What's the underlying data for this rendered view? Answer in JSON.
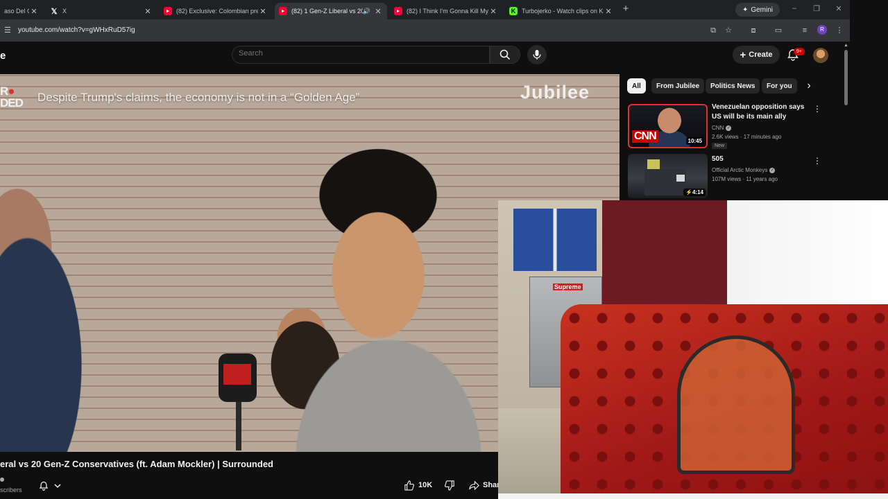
{
  "browser": {
    "tabs": [
      {
        "title": "aso Del G",
        "favicon": "site-icon",
        "active": false
      },
      {
        "title": "X",
        "favicon": "x-icon",
        "active": false
      },
      {
        "title": "(82) Exclusive: Colombian pres",
        "favicon": "youtube-icon",
        "active": false
      },
      {
        "title": "(82) 1 Gen-Z Liberal vs 20 G",
        "favicon": "youtube-icon",
        "active": true,
        "audio": true
      },
      {
        "title": "(82) I Think I'm Gonna Kill Mys",
        "favicon": "youtube-icon",
        "active": false
      },
      {
        "title": "Turbojerko - Watch clips on Ki",
        "favicon": "kick-icon",
        "active": false
      }
    ],
    "new_tab": "+",
    "gemini_label": "Gemini",
    "url": "youtube.com/watch?v=gWHxRuD57ig",
    "profile_initial": "R"
  },
  "youtube": {
    "logo_fragment": "e",
    "search_placeholder": "Search",
    "create_label": "Create",
    "notification_count": "9+",
    "video": {
      "overlay_left": [
        "R",
        "DED"
      ],
      "caption": "Despite Trump's claims, the economy is not in a “Golden Age”",
      "brand": "Jubilee",
      "title": "eral vs 20 Gen-Z Conservatives (ft. Adam Mockler) | Surrounded",
      "subscribers_fragment": "scribers",
      "likes": "10K",
      "share_label": "Shar"
    },
    "chips": [
      {
        "label": "All",
        "active": true
      },
      {
        "label": "From Jubilee",
        "active": false
      },
      {
        "label": "Politics News",
        "active": false
      },
      {
        "label": "For you",
        "active": false
      }
    ],
    "recommendations": [
      {
        "title": "Venezuelan opposition says US will be its main ally",
        "channel": "CNN",
        "verified": true,
        "meta": "2.6K views · 17 minutes ago",
        "badge": "New",
        "duration": "10:45",
        "thumb_text": "CNN"
      },
      {
        "title": "505",
        "channel": "Official Arctic Monkeys",
        "verified": true,
        "meta": "107M views · 11 years ago",
        "duration": "4:14"
      }
    ]
  },
  "webcam": {
    "sticker_text": "Supreme"
  },
  "colors": {
    "youtube_bg": "#0f0f0f",
    "youtube_red": "#ff0033",
    "chrome_tabstrip": "#202124",
    "chrome_toolbar": "#35363a"
  }
}
